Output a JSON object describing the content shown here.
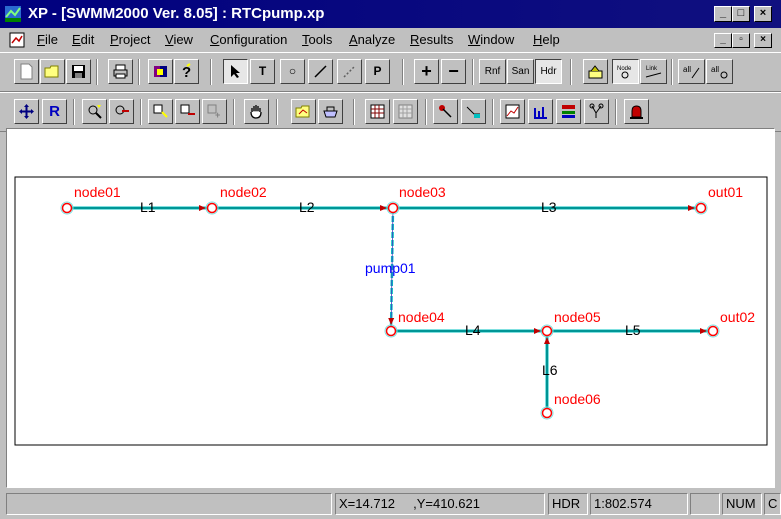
{
  "window": {
    "title": "XP - [SWMM2000 Ver. 8.05] : RTCpump.xp",
    "caption_buttons": [
      "minimize",
      "maximize",
      "close"
    ]
  },
  "menu": {
    "items": [
      "File",
      "Edit",
      "Project",
      "View",
      "Configuration",
      "Tools",
      "Analyze",
      "Results",
      "Window",
      "Help"
    ],
    "mdi_buttons": [
      "minimize",
      "restore",
      "close"
    ]
  },
  "toolbar1": {
    "buttons": [
      {
        "name": "new",
        "icon": "new-document-icon"
      },
      {
        "name": "open",
        "icon": "open-folder-icon"
      },
      {
        "name": "save",
        "icon": "save-disk-icon"
      },
      {
        "name": "print",
        "icon": "printer-icon"
      },
      {
        "name": "book",
        "icon": "book-icon"
      },
      {
        "name": "help",
        "icon": "help-question-icon"
      },
      {
        "name": "select",
        "icon": "arrow-cursor-icon",
        "label": "↖",
        "pressed": true
      },
      {
        "name": "text",
        "label": "T"
      },
      {
        "name": "circle",
        "label": "○"
      },
      {
        "name": "line",
        "label": "/"
      },
      {
        "name": "dashed-line",
        "label": "⁄"
      },
      {
        "name": "p-tool",
        "label": "P"
      },
      {
        "name": "zoom-in",
        "label": "+"
      },
      {
        "name": "zoom-out",
        "label": "−"
      },
      {
        "name": "rnf",
        "label": "Rnf"
      },
      {
        "name": "san",
        "label": "San"
      },
      {
        "name": "hdr",
        "label": "Hdr",
        "pressed": true
      },
      {
        "name": "layers",
        "icon": "layers-icon"
      },
      {
        "name": "node-mode",
        "label": "Node"
      },
      {
        "name": "link-mode",
        "label": "Link"
      },
      {
        "name": "all-links",
        "label": "all"
      },
      {
        "name": "all-nodes",
        "label": "all"
      }
    ]
  },
  "toolbar2": {
    "buttons": [
      {
        "name": "pan",
        "icon": "move-arrows-icon"
      },
      {
        "name": "redraw",
        "label": "R"
      },
      {
        "name": "zoom-window",
        "icon": "zoom-window-icon"
      },
      {
        "name": "zoom-previous",
        "icon": "zoom-previous-icon"
      },
      {
        "name": "add-node",
        "icon": "add-node-icon"
      },
      {
        "name": "delete-node",
        "icon": "delete-node-icon"
      },
      {
        "name": "disabled-node",
        "icon": "disabled-node-icon"
      },
      {
        "name": "hand",
        "icon": "hand-icon"
      },
      {
        "name": "open-graph",
        "icon": "open-graph-icon"
      },
      {
        "name": "tub",
        "icon": "tub-icon"
      },
      {
        "name": "grid1",
        "icon": "grid-icon"
      },
      {
        "name": "grid2",
        "icon": "grid-disabled-icon"
      },
      {
        "name": "pointer-red",
        "icon": "pointer-icon"
      },
      {
        "name": "profile",
        "icon": "profile-icon"
      },
      {
        "name": "chart",
        "icon": "chart-icon"
      },
      {
        "name": "hydrograph",
        "icon": "hydrograph-icon"
      },
      {
        "name": "network",
        "icon": "network-icon"
      },
      {
        "name": "tree",
        "icon": "tree-icon"
      },
      {
        "name": "alarm",
        "icon": "alarm-icon"
      }
    ]
  },
  "network": {
    "nodes": [
      {
        "id": "node01",
        "label": "node01"
      },
      {
        "id": "node02",
        "label": "node02"
      },
      {
        "id": "node03",
        "label": "node03"
      },
      {
        "id": "out01",
        "label": "out01"
      },
      {
        "id": "node04",
        "label": "node04"
      },
      {
        "id": "node05",
        "label": "node05"
      },
      {
        "id": "out02",
        "label": "out02"
      },
      {
        "id": "node06",
        "label": "node06"
      }
    ],
    "links": [
      {
        "id": "L1",
        "label": "L1",
        "from": "node01",
        "to": "node02"
      },
      {
        "id": "L2",
        "label": "L2",
        "from": "node02",
        "to": "node03"
      },
      {
        "id": "L3",
        "label": "L3",
        "from": "node03",
        "to": "out01"
      },
      {
        "id": "pump01",
        "label": "pump01",
        "from": "node03",
        "to": "node04"
      },
      {
        "id": "L4",
        "label": "L4",
        "from": "node04",
        "to": "node05"
      },
      {
        "id": "L5",
        "label": "L5",
        "from": "node05",
        "to": "out02"
      },
      {
        "id": "L6",
        "label": "L6",
        "from": "node06",
        "to": "node05"
      }
    ],
    "colors": {
      "node": "#ff0000",
      "link": "#00c0c0",
      "link_label": "#000000",
      "pump_label": "#0000ff"
    }
  },
  "status": {
    "x": "X=14.712",
    "y": ",Y=410.621",
    "mode": "HDR",
    "scale": "1:802.574",
    "blank": "",
    "num": "NUM",
    "tail": "C"
  }
}
